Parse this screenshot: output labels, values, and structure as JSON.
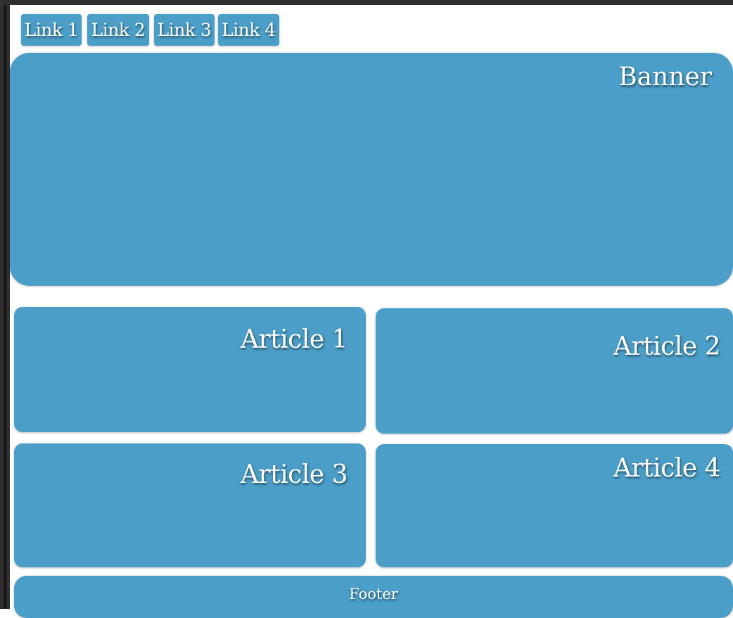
{
  "nav": {
    "links": [
      "Link 1",
      "Link 2",
      "Link 3",
      "Link 4"
    ]
  },
  "banner": {
    "label": "Banner"
  },
  "articles": [
    {
      "label": "Article 1"
    },
    {
      "label": "Article 2"
    },
    {
      "label": "Article 3"
    },
    {
      "label": "Article 4"
    }
  ],
  "footer": {
    "label": "Footer"
  },
  "colors": {
    "panel_blue": "#4a9ec7",
    "frame_dark": "#2f2f2f",
    "text": "#ffffff"
  }
}
